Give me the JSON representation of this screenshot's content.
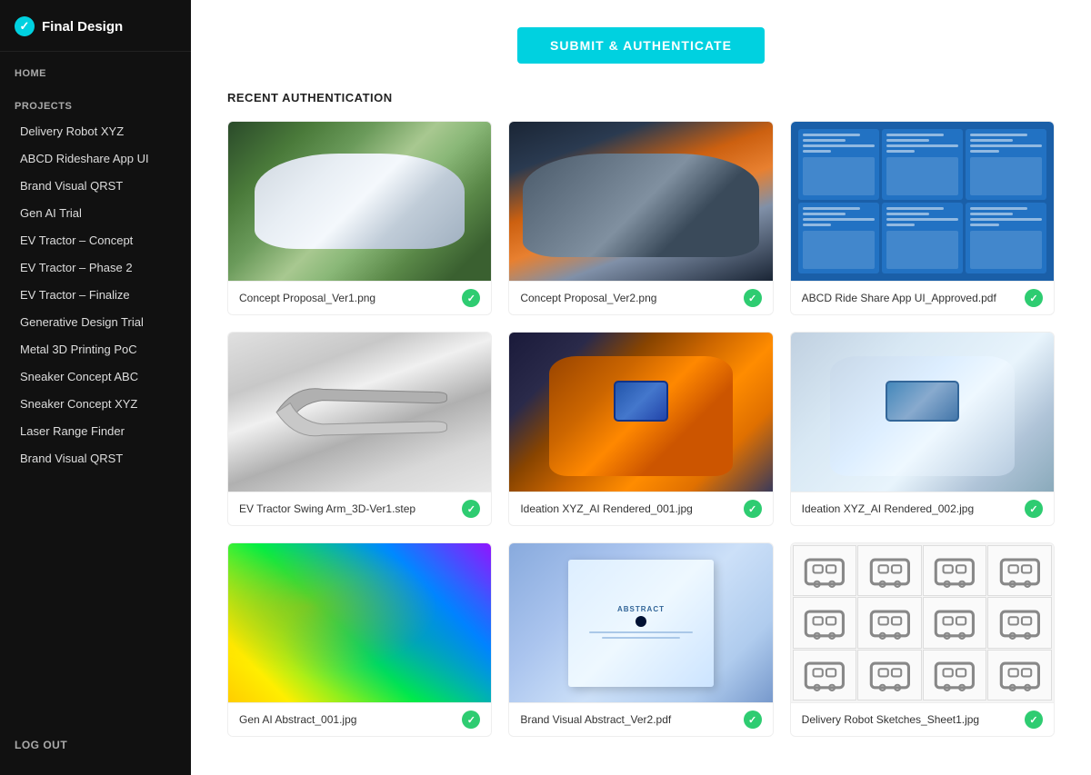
{
  "app": {
    "name": "Final Design",
    "logo_label": "Final Design"
  },
  "sidebar": {
    "home_label": "HOME",
    "projects_label": "PROJECTS",
    "logout_label": "LOG OUT",
    "nav_items": [
      {
        "id": "delivery-robot",
        "label": "Delivery Robot XYZ"
      },
      {
        "id": "abcd-rideshare",
        "label": "ABCD Rideshare App UI"
      },
      {
        "id": "brand-visual",
        "label": "Brand Visual QRST"
      },
      {
        "id": "gen-ai-trial",
        "label": "Gen AI Trial"
      },
      {
        "id": "ev-tractor-concept",
        "label": "EV Tractor – Concept"
      },
      {
        "id": "ev-tractor-phase2",
        "label": "EV Tractor – Phase 2"
      },
      {
        "id": "ev-tractor-finalize",
        "label": "EV Tractor – Finalize"
      },
      {
        "id": "generative-design",
        "label": "Generative Design Trial"
      },
      {
        "id": "metal-3d",
        "label": "Metal 3D Printing PoC"
      },
      {
        "id": "sneaker-abc",
        "label": "Sneaker Concept ABC"
      },
      {
        "id": "sneaker-xyz",
        "label": "Sneaker Concept XYZ"
      },
      {
        "id": "laser-range",
        "label": "Laser Range Finder"
      },
      {
        "id": "brand-visual-2",
        "label": "Brand Visual QRST"
      }
    ]
  },
  "main": {
    "submit_btn": "SUBMIT & AUTHENTICATE",
    "section_title": "RECENT AUTHENTICATION",
    "gallery_items": [
      {
        "id": "ev1",
        "filename": "Concept Proposal_Ver1.png",
        "authenticated": true,
        "type": "ev-tractor-1"
      },
      {
        "id": "ev2",
        "filename": "Concept Proposal_Ver2.png",
        "authenticated": true,
        "type": "ev-tractor-2"
      },
      {
        "id": "appui",
        "filename": "ABCD Ride Share App UI_Approved.pdf",
        "authenticated": true,
        "type": "app-ui"
      },
      {
        "id": "metal",
        "filename": "EV Tractor Swing Arm_3D-Ver1.step",
        "authenticated": true,
        "type": "metal-part"
      },
      {
        "id": "orange",
        "filename": "Ideation XYZ_AI Rendered_001.jpg",
        "authenticated": true,
        "type": "delivery-orange"
      },
      {
        "id": "white",
        "filename": "Ideation XYZ_AI Rendered_002.jpg",
        "authenticated": true,
        "type": "delivery-white"
      },
      {
        "id": "colorful",
        "filename": "Gen AI Abstract_001.jpg",
        "authenticated": true,
        "type": "colorful"
      },
      {
        "id": "abstract",
        "filename": "Brand Visual Abstract_Ver2.pdf",
        "authenticated": true,
        "type": "abstract-book"
      },
      {
        "id": "sketches",
        "filename": "Delivery Robot Sketches_Sheet1.jpg",
        "authenticated": true,
        "type": "sketches"
      }
    ]
  }
}
